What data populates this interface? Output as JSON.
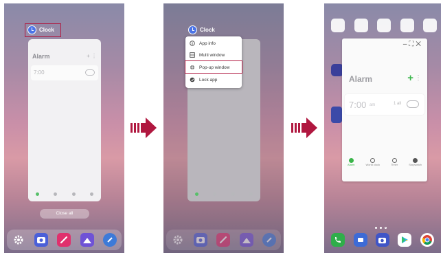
{
  "panel1": {
    "app_title": "Clock",
    "card_header": "Alarm",
    "alarm_time": "7:00",
    "close_all": "Close all"
  },
  "panel2": {
    "app_title": "Clock",
    "menu": [
      "App info",
      "Multi window",
      "Pop-up window",
      "Lock app"
    ]
  },
  "panel3": {
    "header": "Alarm",
    "alarm_time": "7:00",
    "alarm_ampm": "am",
    "alarm_repeat": "1 all",
    "tabs": [
      "Alarm",
      "World clock",
      "Timer",
      "Stopwatch"
    ]
  },
  "colors": {
    "highlight": "#b0173f",
    "accent_green": "#3ab54a",
    "clock_blue": "#4c74e6"
  },
  "dock_icons": [
    "settings-icon",
    "camera-icon",
    "pen-icon",
    "gallery-icon",
    "compass-icon"
  ],
  "home_dock_icons": [
    "phone-icon",
    "messages-icon",
    "camera-icon",
    "play-store-icon",
    "chrome-icon"
  ]
}
